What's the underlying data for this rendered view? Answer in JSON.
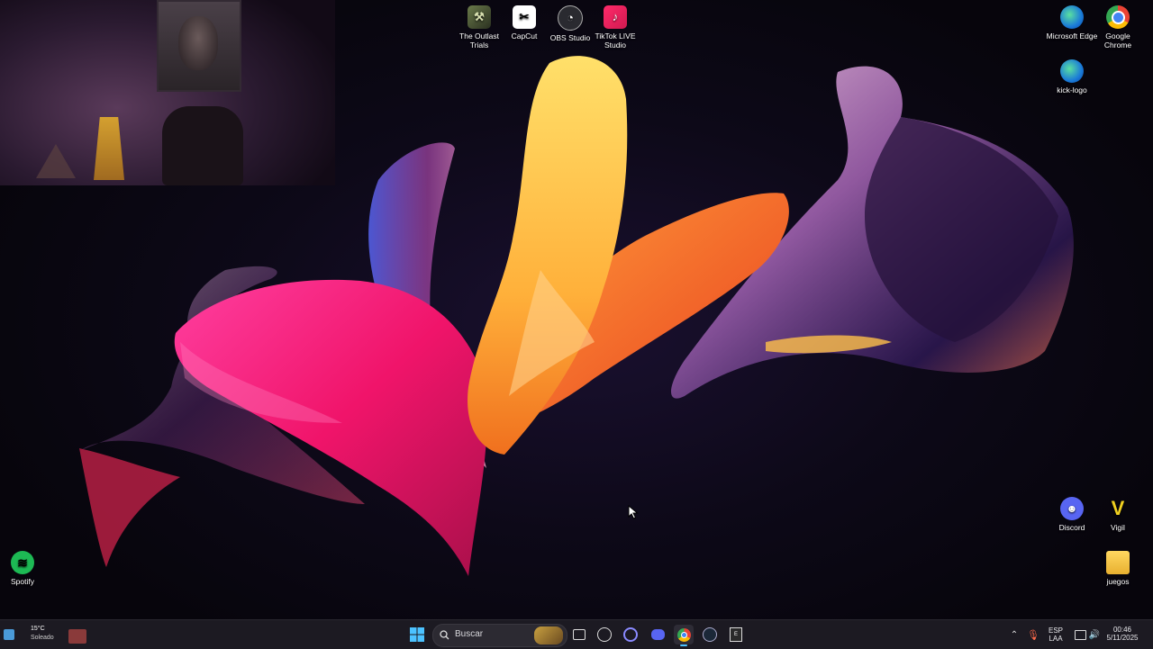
{
  "desktop": {
    "icons_top": [
      {
        "label": "The Outlast Trials",
        "icon": "outlast-trials-icon"
      },
      {
        "label": "CapCut",
        "icon": "capcut-icon"
      },
      {
        "label": "OBS Studio",
        "icon": "obs-studio-icon"
      },
      {
        "label": "TikTok LIVE Studio",
        "icon": "tiktok-live-studio-icon"
      }
    ],
    "icons_right": [
      {
        "label": "Microsoft Edge",
        "icon": "edge-icon"
      },
      {
        "label": "Google Chrome",
        "icon": "chrome-icon"
      },
      {
        "label": "kick-logo",
        "icon": "edge-icon"
      },
      {
        "label": "Discord",
        "icon": "discord-icon"
      },
      {
        "label": "Vigil",
        "icon": "vigil-icon"
      },
      {
        "label": "juegos",
        "icon": "folder-icon"
      }
    ],
    "icons_left": [
      {
        "label": "Spotify",
        "icon": "spotify-icon"
      }
    ]
  },
  "taskbar": {
    "weather_temp": "15°C",
    "weather_text": "Soleado",
    "search_placeholder": "Buscar",
    "pinned": [
      "start-icon",
      "search-icon",
      "task-view-icon",
      "obs-icon",
      "cortana-icon",
      "discord-icon",
      "chrome-icon",
      "steam-icon",
      "epic-games-icon"
    ],
    "language_line1": "ESP",
    "language_line2": "LAA",
    "time": "00:46",
    "date": "5/11/2025",
    "colors": {
      "taskbar_bg": "#1c1a22",
      "accent": "#4cc2ff"
    }
  }
}
